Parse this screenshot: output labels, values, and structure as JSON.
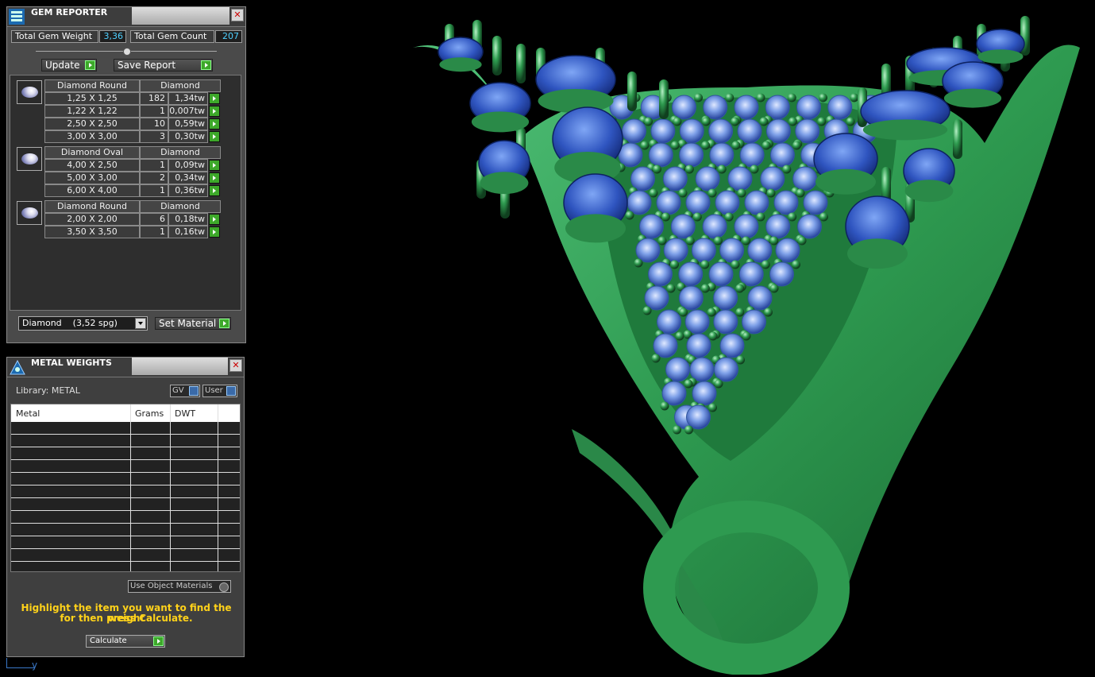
{
  "gem_reporter": {
    "title": "GEM REPORTER",
    "close_icon": "close-icon",
    "total_weight_label": "Total Gem Weight",
    "total_weight_value": "3,36",
    "total_count_label": "Total Gem Count",
    "total_count_value": "207",
    "update_label": "Update",
    "save_report_label": "Save Report",
    "groups": [
      {
        "shape": "Diamond Round",
        "material": "Diamond",
        "rows": [
          {
            "size": "1,25 X 1,25",
            "count": "182",
            "weight": "1,34tw"
          },
          {
            "size": "1,22 X 1,22",
            "count": "1",
            "weight": "0,007tw"
          },
          {
            "size": "2,50 X 2,50",
            "count": "10",
            "weight": "0,59tw"
          },
          {
            "size": "3,00 X 3,00",
            "count": "3",
            "weight": "0,30tw"
          }
        ]
      },
      {
        "shape": "Diamond Oval",
        "material": "Diamond",
        "rows": [
          {
            "size": "4,00 X 2,50",
            "count": "1",
            "weight": "0,09tw"
          },
          {
            "size": "5,00 X 3,00",
            "count": "2",
            "weight": "0,34tw"
          },
          {
            "size": "6,00 X 4,00",
            "count": "1",
            "weight": "0,36tw"
          }
        ]
      },
      {
        "shape": "Diamond Round",
        "material": "Diamond",
        "rows": [
          {
            "size": "2,00 X 2,00",
            "count": "6",
            "weight": "0,18tw"
          },
          {
            "size": "3,50 X 3,50",
            "count": "1",
            "weight": "0,16tw"
          }
        ]
      }
    ],
    "material_select_value": "Diamond    (3,52 spg)",
    "set_material_label": "Set Material"
  },
  "metal_weights": {
    "title": "METAL WEIGHTS",
    "library_label": "Library: METAL",
    "gv_label": "GV",
    "user_label": "User",
    "columns": [
      "Metal",
      "Grams",
      "DWT"
    ],
    "use_object_materials_label": "Use Object Materials",
    "hint_line1": "Highlight the item you want to find the weight",
    "hint_line2": "for then press Calculate.",
    "calculate_label": "Calculate"
  },
  "axis_label": "y",
  "colors": {
    "panel_bg": "#4a4a4a",
    "value_cyan": "#4fd0ff",
    "hint_yellow": "#ffd21a",
    "play_green": "#3da82a",
    "model_green": "#2e9a50",
    "gem_blue": "#2c50b8"
  }
}
